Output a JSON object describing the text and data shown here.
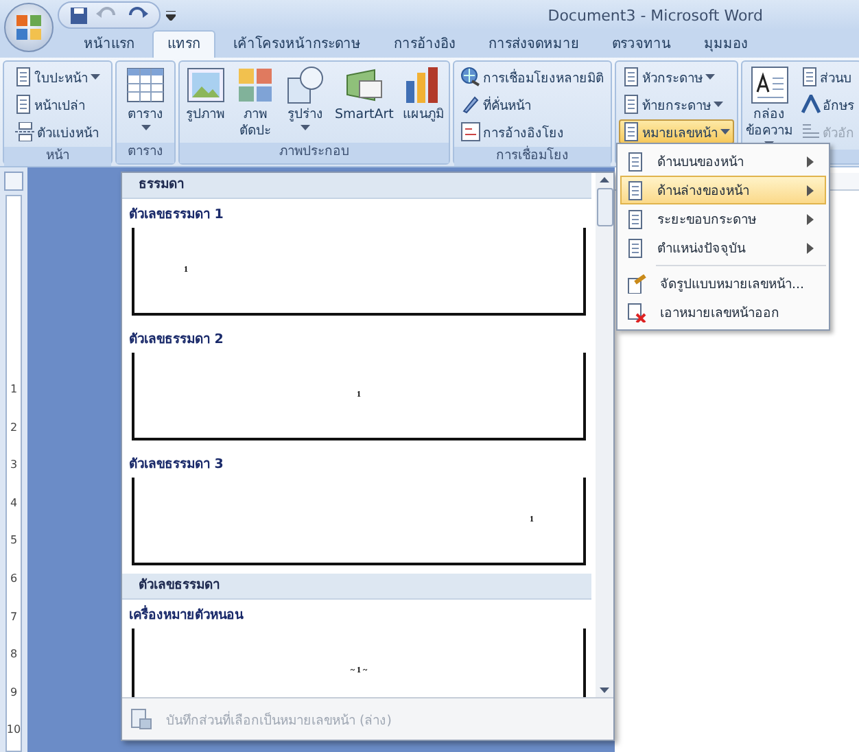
{
  "window": {
    "title": "Document3 - Microsoft Word"
  },
  "tabs": [
    {
      "label": "หน้าแรก",
      "selected": false
    },
    {
      "label": "แทรก",
      "selected": true
    },
    {
      "label": "เค้าโครงหน้ากระดาษ",
      "selected": false
    },
    {
      "label": "การอ้างอิง",
      "selected": false
    },
    {
      "label": "การส่งจดหมาย",
      "selected": false
    },
    {
      "label": "ตรวจทาน",
      "selected": false
    },
    {
      "label": "มุมมอง",
      "selected": false
    }
  ],
  "ribbon_groups": [
    {
      "label": "หน้า",
      "kind": "small",
      "items": [
        {
          "label": "ใบปะหน้า",
          "dropdown": true,
          "open": false
        },
        {
          "label": "หน้าเปล่า",
          "dropdown": false,
          "open": false
        },
        {
          "label": "ตัวแบ่งหน้า",
          "dropdown": false,
          "open": false
        }
      ]
    },
    {
      "label": "ตาราง",
      "kind": "large",
      "items": [
        {
          "label": "ตาราง",
          "dropdown": true
        }
      ]
    },
    {
      "label": "ภาพประกอบ",
      "kind": "large",
      "items": [
        {
          "label": "รูปภาพ",
          "dropdown": false
        },
        {
          "label": "ภาพ\nตัดปะ",
          "dropdown": false
        },
        {
          "label": "รูปร่าง",
          "dropdown": true
        },
        {
          "label": "SmartArt",
          "dropdown": false
        },
        {
          "label": "แผนภูมิ",
          "dropdown": false
        }
      ]
    },
    {
      "label": "การเชื่อมโยง",
      "kind": "small",
      "items": [
        {
          "label": "การเชื่อมโยงหลายมิติ",
          "dropdown": false,
          "open": false
        },
        {
          "label": "ที่คั่นหน้า",
          "dropdown": false,
          "open": false
        },
        {
          "label": "การอ้างอิงโยง",
          "dropdown": false,
          "open": false
        }
      ]
    },
    {
      "kind": "small",
      "items": [
        {
          "label": "หัวกระดาษ",
          "dropdown": true,
          "open": false
        },
        {
          "label": "ท้ายกระดาษ",
          "dropdown": true,
          "open": false
        },
        {
          "label": "หมายเลขหน้า",
          "dropdown": true,
          "open": true
        }
      ]
    },
    {
      "kind": "text",
      "large": {
        "label": "กล่อง\nข้อความ",
        "dropdown": true
      },
      "items": [
        {
          "label": "ส่วนบ",
          "disabled": false
        },
        {
          "label": "อักษร",
          "disabled": false
        },
        {
          "label": "ตัวอัก",
          "disabled": true
        }
      ]
    }
  ],
  "page_number_menu": [
    {
      "label": "ด้านบนของหน้า",
      "submenu": true,
      "selected": false
    },
    {
      "label": "ด้านล่างของหน้า",
      "submenu": true,
      "selected": true
    },
    {
      "label": "ระยะขอบกระดาษ",
      "submenu": true,
      "selected": false
    },
    {
      "label": "ตำแหน่งปัจจุบัน",
      "submenu": true,
      "selected": false
    },
    {
      "label": "จัดรูปแบบหมายเลขหน้า...",
      "submenu": false,
      "selected": false
    },
    {
      "label": "เอาหมายเลขหน้าออก",
      "submenu": false,
      "selected": false
    }
  ],
  "gallery": {
    "sections": [
      {
        "heading": "ธรรมดา",
        "items": [
          {
            "title": "ตัวเลขธรรมดา 1",
            "number": "1",
            "kind": "left"
          },
          {
            "title": "ตัวเลขธรรมดา 2",
            "number": "1",
            "kind": "center"
          },
          {
            "title": "ตัวเลขธรรมดา 3",
            "number": "1",
            "kind": "right"
          }
        ]
      },
      {
        "heading": "ตัวเลขธรรมดา",
        "items": [
          {
            "title": "เครื่องหมายตัวหนอน",
            "number": "~ 1 ~",
            "kind": "center"
          }
        ]
      }
    ],
    "footer": {
      "label": "บันทึกส่วนที่เลือกเป็นหมายเลขหน้า (ล่าง)",
      "disabled": true
    }
  },
  "vertical_ruler": [
    "1",
    "2",
    "3",
    "4",
    "5",
    "6",
    "7",
    "8",
    "9",
    "10"
  ]
}
